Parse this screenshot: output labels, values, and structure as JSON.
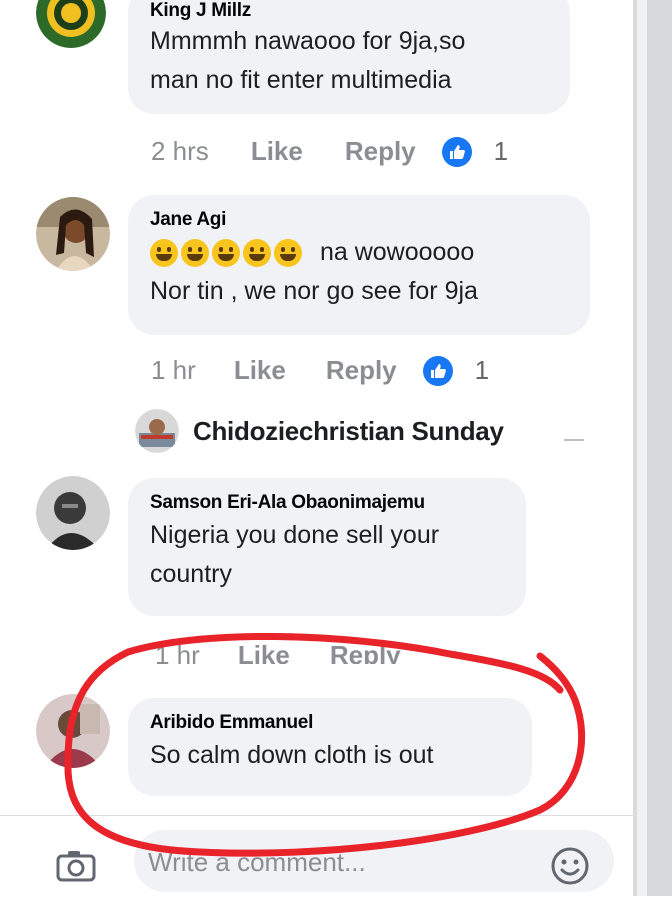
{
  "comments": [
    {
      "author": "King J Millz",
      "text_lines": [
        "Mmmmh nawaooo for 9ja,so",
        "man no fit enter multimedia"
      ],
      "time": "2 hrs",
      "like_label": "Like",
      "reply_label": "Reply",
      "reaction_count": "1"
    },
    {
      "author": "Jane Agi",
      "emoji_text": "na wowooooo",
      "text_line2": "Nor tin , we nor go see for 9ja",
      "time": "1 hr",
      "like_label": "Like",
      "reply_label": "Reply",
      "reaction_count": "1"
    },
    {
      "author": "Samson Eri-Ala Obaonimajemu",
      "text_lines": [
        "Nigeria you done sell your",
        "country"
      ],
      "time": "1 hr",
      "like_label": "Like",
      "reply_label": "Reply"
    },
    {
      "author": "Aribido Emmanuel",
      "text": "So calm down cloth is out"
    }
  ],
  "reply_thread": {
    "name": "Chidoziechristian Sunday"
  },
  "composer": {
    "placeholder": "Write a comment..."
  },
  "colors": {
    "accent": "#1877f2",
    "bubble": "#f0f2f5",
    "annotation": "#e8232a"
  }
}
